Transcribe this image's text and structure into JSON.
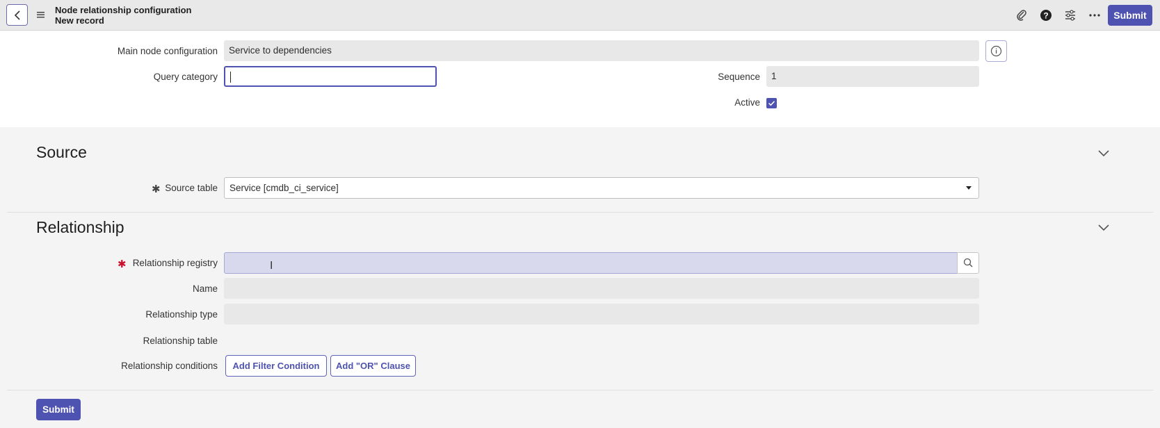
{
  "header": {
    "title": "Node relationship configuration",
    "subtitle": "New record",
    "submit_label": "Submit",
    "icons": [
      "chevron-left-icon",
      "hamburger-menu-icon",
      "paperclip-icon",
      "help-icon",
      "settings-sliders-icon",
      "more-icon"
    ]
  },
  "form": {
    "main_node_label": "Main node configuration",
    "main_node_value": "Service to dependencies",
    "query_category_label": "Query category",
    "query_category_value": "",
    "sequence_label": "Sequence",
    "sequence_value": "1",
    "active_label": "Active",
    "active_checked": true
  },
  "source": {
    "title": "Source",
    "source_table_label": "Source table",
    "source_table_value": "Service [cmdb_ci_service]"
  },
  "relationship": {
    "title": "Relationship",
    "registry_label": "Relationship registry",
    "registry_value": "",
    "name_label": "Name",
    "type_label": "Relationship type",
    "table_label": "Relationship table",
    "conditions_label": "Relationship conditions",
    "add_filter_label": "Add Filter Condition",
    "add_or_label": "Add \"OR\" Clause"
  },
  "footer": {
    "submit_label": "Submit"
  },
  "colors": {
    "accent": "#4e52b0",
    "required": "#c8102e"
  }
}
